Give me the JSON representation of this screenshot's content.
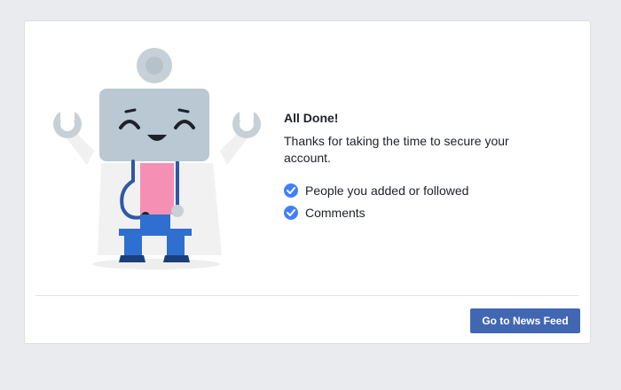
{
  "dialog": {
    "title": "All Done!",
    "description": "Thanks for taking the time to secure your account.",
    "checklist": [
      {
        "label": "People you added or followed",
        "icon": "check-circle-icon"
      },
      {
        "label": "Comments",
        "icon": "check-circle-icon"
      }
    ],
    "button_label": "Go to News Feed"
  },
  "colors": {
    "page_background": "#e9ebee",
    "check_blue": "#4080ff",
    "button_blue": "#4267b2"
  }
}
